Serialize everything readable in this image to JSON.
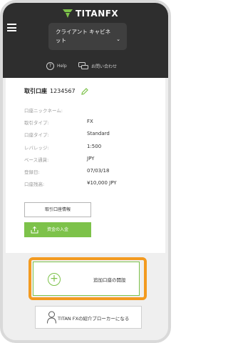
{
  "header": {
    "logo_text": "TITANFX",
    "client_nav_line1": "クライアント キャビネ",
    "client_nav_line2": "ット",
    "help_label": "Help",
    "contact_label": "お問い合わせ"
  },
  "account": {
    "title": "取引口座",
    "number": "1234567",
    "fields": [
      {
        "label": "口座ニックネーム:",
        "value": ""
      },
      {
        "label": "取引タイプ:",
        "value": "FX"
      },
      {
        "label": "口座タイプ:",
        "value": "Standard"
      },
      {
        "label": "レバレッジ:",
        "value": "1:500"
      },
      {
        "label": "ベース通貨:",
        "value": "JPY"
      },
      {
        "label": "登録日:",
        "value": "07/03/18"
      },
      {
        "label": "口座残高:",
        "value": "¥10,000 JPY"
      }
    ],
    "info_button": "取引口座情報",
    "deposit_button": "資金の入金"
  },
  "add_account": {
    "label": "追加口座の開設"
  },
  "ib": {
    "label": "TITAN FXの紹介ブローカーになる"
  },
  "colors": {
    "accent_green": "#7dc24a",
    "highlight_orange": "#f39a20",
    "header_dark": "#2e2e2e"
  }
}
